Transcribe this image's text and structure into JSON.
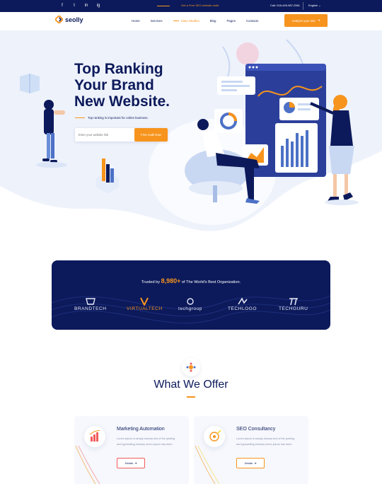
{
  "topbar": {
    "social_icons": [
      "facebook-icon",
      "twitter-icon",
      "linkedin-icon",
      "instagram-icon"
    ],
    "social_glyphs": [
      "f",
      "t",
      "in",
      "ig"
    ],
    "promo": "Get a Free SEO website audit",
    "phone": "Call: 018-445-987-2561",
    "language": "English"
  },
  "nav": {
    "logo_text": "seolly",
    "menu": [
      "Home",
      "Services",
      "Case Studies",
      "Blog",
      "Pages",
      "Contacts"
    ],
    "active_index": 2,
    "cta_label": "Analyze your site"
  },
  "hero": {
    "title_lines": [
      "Top Ranking",
      "Your Brand",
      "New Website."
    ],
    "subtitle": "Top ranking is important for online business.",
    "email_placeholder": "Enter your website link",
    "submit_label": "Free Audit Now"
  },
  "trusted": {
    "prefix": "Trusted by",
    "count": "8,980+",
    "suffix": "of The World's Best Organization.",
    "brands": [
      "BRANDTECH",
      "VIRTUALTECH",
      "techgroup",
      "TECHLOGO",
      "TECHGURU"
    ]
  },
  "offer": {
    "title": "What We Offer",
    "cards": [
      {
        "title": "Marketing Automation",
        "desc": "Lorem ipsum is simply dummy text of the printing and typesetting industry lorem ipsum has been.",
        "button": "Details"
      },
      {
        "title": "SEO Consultancy",
        "desc": "Lorem ipsum is simply dummy text of the printing and typesetting industry lorem ipsum has been.",
        "button": "Details"
      }
    ]
  },
  "colors": {
    "navy": "#0c1a5b",
    "accent_orange": "#f7941d",
    "accent_red": "#f15b5b",
    "hero_bg": "#f1f4fc"
  }
}
